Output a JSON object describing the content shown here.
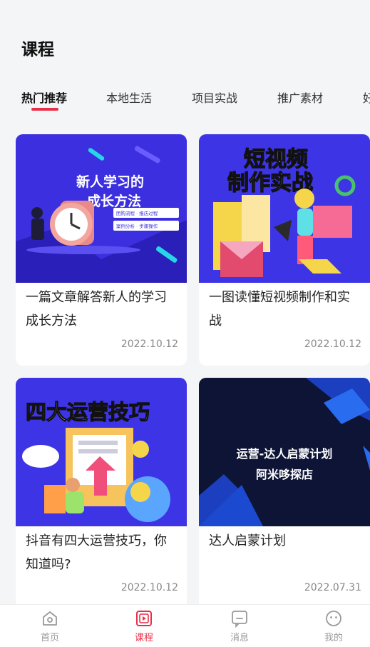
{
  "header": {
    "title": "课程"
  },
  "tabs": [
    {
      "label": "热门推荐",
      "active": true
    },
    {
      "label": "本地生活",
      "active": false
    },
    {
      "label": "项目实战",
      "active": false
    },
    {
      "label": "推广素材",
      "active": false
    },
    {
      "label": "好",
      "active": false
    }
  ],
  "cards": [
    {
      "title": "一篇文章解答新人的学习成长方法",
      "date": "2022.10.12",
      "thumb": {
        "headline_l1": "新人学习的",
        "headline_l2": "成长方法",
        "tag1": "团购流程 · 报店过程",
        "tag2": "案例分析 · 步骤操作"
      }
    },
    {
      "title": "一图读懂短视频制作和实战",
      "date": "2022.10.12",
      "thumb": {
        "headline_l1": "短视频",
        "headline_l2": "制作实战"
      }
    },
    {
      "title": "抖音有四大运营技巧，你知道吗?",
      "date": "2022.10.12",
      "thumb": {
        "headline_l1": "四大运营技巧"
      }
    },
    {
      "title": "达人启蒙计划",
      "date": "2022.07.31",
      "thumb": {
        "headline_l1": "运营-达人启蒙计划",
        "headline_l2": "阿米哆探店"
      }
    }
  ],
  "tabbar": [
    {
      "label": "首页",
      "icon": "home-icon",
      "active": false
    },
    {
      "label": "课程",
      "icon": "course-icon",
      "active": true
    },
    {
      "label": "消息",
      "icon": "message-icon",
      "active": false
    },
    {
      "label": "我的",
      "icon": "profile-icon",
      "active": false
    }
  ],
  "colors": {
    "accent": "#e8304a",
    "thumb_blue": "#3d34e6",
    "thumb_dark": "#0d1436"
  }
}
